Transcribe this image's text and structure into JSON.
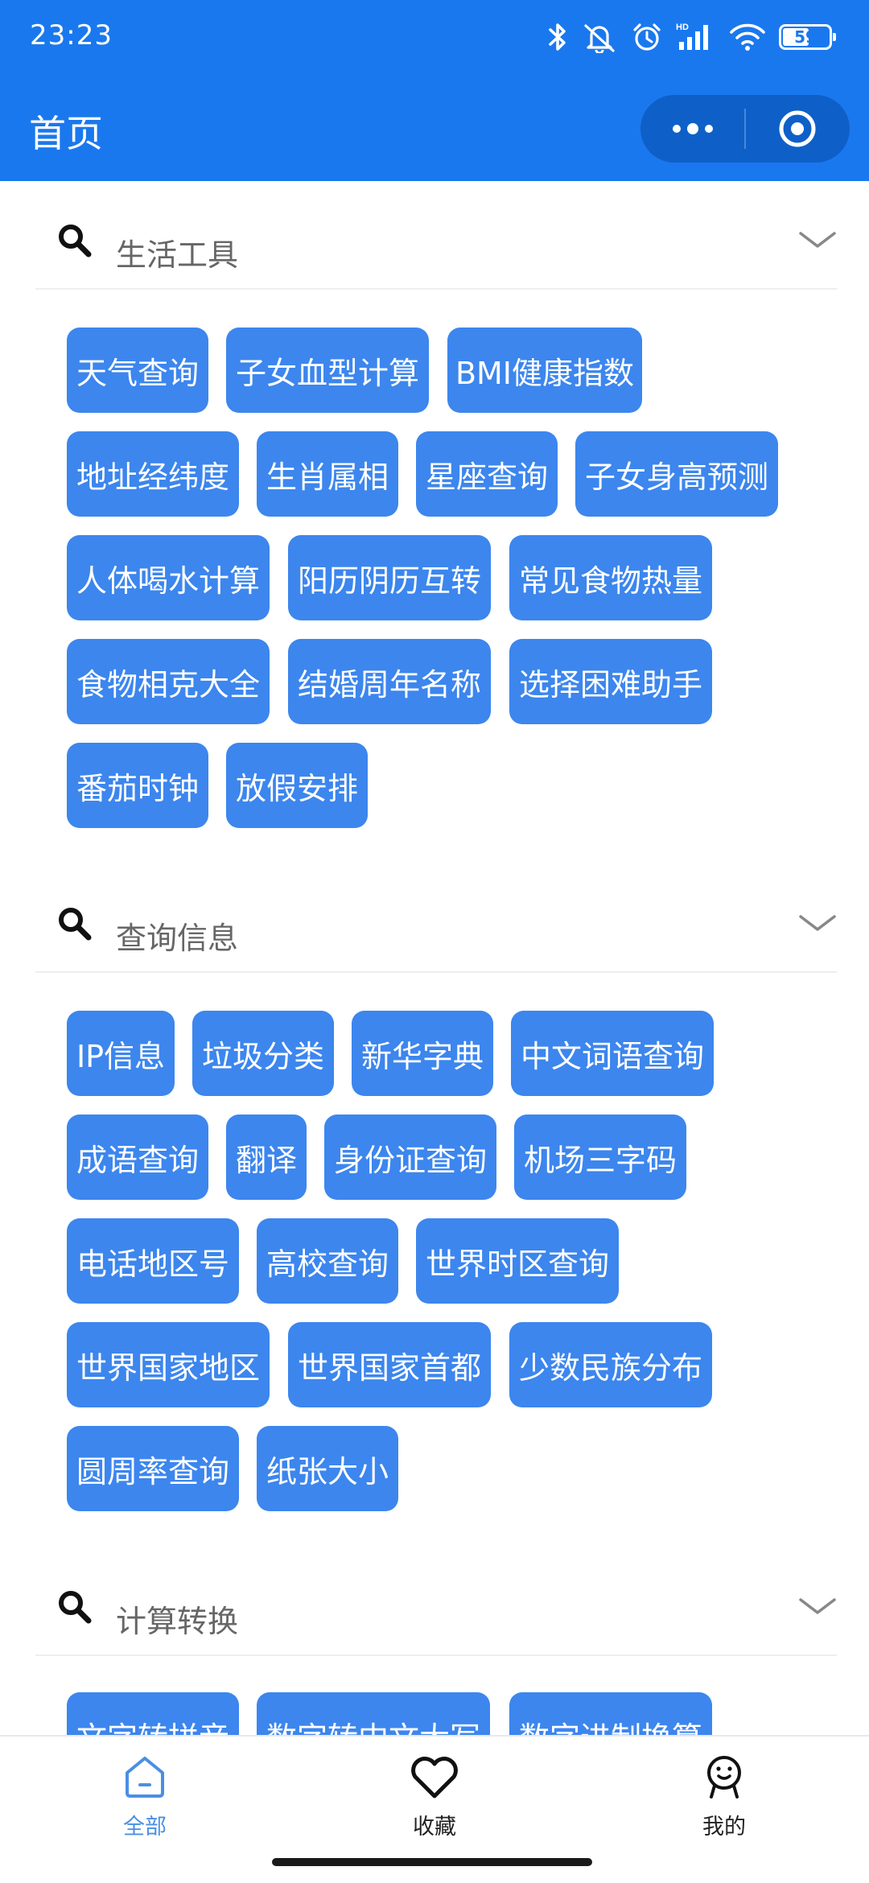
{
  "status_bar": {
    "time": "23:23",
    "battery": "59",
    "icons": [
      "bluetooth-icon",
      "mute-icon",
      "alarm-icon",
      "hd-signal-icon",
      "wifi-icon",
      "battery-icon"
    ]
  },
  "header": {
    "title": "首页",
    "capsule_icons": [
      "more-dots-icon",
      "close-target-icon"
    ]
  },
  "sections": [
    {
      "title": "生活工具",
      "items": [
        "天气查询",
        "子女血型计算",
        "BMI健康指数",
        "地址经纬度",
        "生肖属相",
        "星座查询",
        "子女身高预测",
        "人体喝水计算",
        "阳历阴历互转",
        "常见食物热量",
        "食物相克大全",
        "结婚周年名称",
        "选择困难助手",
        "番茄时钟",
        "放假安排"
      ]
    },
    {
      "title": "查询信息",
      "items": [
        "IP信息",
        "垃圾分类",
        "新华字典",
        "中文词语查询",
        "成语查询",
        "翻译",
        "身份证查询",
        "机场三字码",
        "电话地区号",
        "高校查询",
        "世界时区查询",
        "世界国家地区",
        "世界国家首都",
        "少数民族分布",
        "圆周率查询",
        "纸张大小"
      ]
    },
    {
      "title": "计算转换",
      "items": [
        "文字转拼音",
        "数字转中文大写",
        "数字进制换算"
      ]
    }
  ],
  "bottom_nav": [
    {
      "label": "全部",
      "icon": "home-icon",
      "active": true
    },
    {
      "label": "收藏",
      "icon": "heart-icon",
      "active": false
    },
    {
      "label": "我的",
      "icon": "profile-icon",
      "active": false
    }
  ],
  "colors": {
    "primary": "#1a78ee",
    "tag": "#3c86ee",
    "active_nav": "#4a8fe3"
  }
}
